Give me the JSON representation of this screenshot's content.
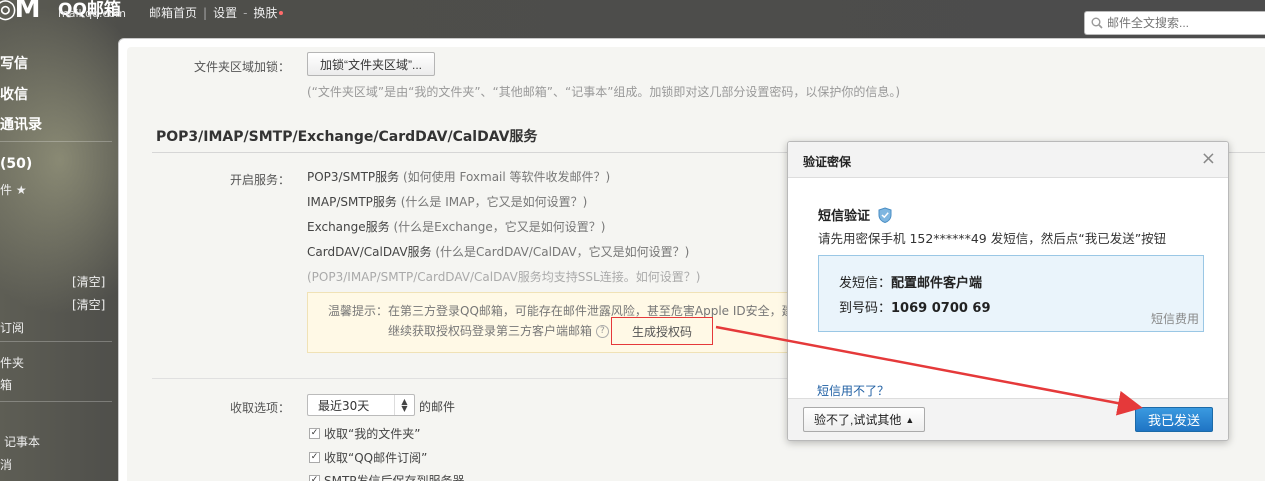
{
  "topbar": {
    "logo_text": "QQ邮箱",
    "logo_url": "mail.qq.com",
    "nav_home": "邮箱首页",
    "nav_settings": "设置",
    "nav_skin": "换肤",
    "search_placeholder": "邮件全文搜索..."
  },
  "sidebar": {
    "write": "写信",
    "receive": "收信",
    "contacts": "通讯录",
    "inbox_count": "(50)",
    "starred": "件 ★",
    "clear1": "[清空]",
    "clear2": "[清空]",
    "subscription": "订阅",
    "folder": "件夹",
    "box": "箱",
    "notes": "记事本",
    "other": "消"
  },
  "settings": {
    "folder_lock_label": "文件夹区域加锁：",
    "folder_lock_button": "加锁“文件夹区域”...",
    "folder_lock_hint": "(“文件夹区域”是由“我的文件夹”、“其他邮箱”、“记事本”组成。加锁即对这几部分设置密码，以保护你的信息。)",
    "section_title": "POP3/IMAP/SMTP/Exchange/CardDAV/CalDAV服务",
    "enable_label": "开启服务：",
    "services": [
      {
        "name": "POP3/SMTP服务",
        "help": "(如何使用 Foxmail 等软件收发邮件？)"
      },
      {
        "name": "IMAP/SMTP服务",
        "help": "(什么是 IMAP，它又是如何设置？)"
      },
      {
        "name": "Exchange服务",
        "help": "(什么是Exchange，它又是如何设置？)"
      },
      {
        "name": "CardDAV/CalDAV服务",
        "help": "(什么是CardDAV/CalDAV，它又是如何设置？)"
      }
    ],
    "ssl_note": "(POP3/IMAP/SMTP/CardDAV/CalDAV服务均支持SSL连接。如何设置？)",
    "tip_line1": "温馨提示：在第三方登录QQ邮箱，可能存在邮件泄露风险，甚至危害Apple ID安全，建",
    "tip_line2": "继续获取授权码登录第三方客户端邮箱",
    "tip_q": "?",
    "generate_code": "生成授权码",
    "receive_label": "收取选项：",
    "receive_select": "最近30天",
    "receive_suffix": "的邮件",
    "checks": [
      "收取“我的文件夹”",
      "收取“QQ邮件订阅”",
      "SMTP发信后保存到服务器"
    ]
  },
  "modal": {
    "title": "验证密保",
    "close": "×",
    "sms_title": "短信验证",
    "sms_desc": "请先用密保手机 152******49 发短信，然后点“我已发送”按钮",
    "send_label": "发短信：",
    "send_content": "配置邮件客户端",
    "to_label": "到号码：",
    "to_number": "1069 0700 69",
    "fee": "短信费用",
    "cant_use": "短信用不了？",
    "other_button": "验不了,试试其他",
    "sent_button": "我已发送"
  },
  "colors": {
    "accent_blue": "#1f74c4",
    "annotation_red": "#e5393a",
    "sms_box_bg": "#eaf4fb"
  }
}
